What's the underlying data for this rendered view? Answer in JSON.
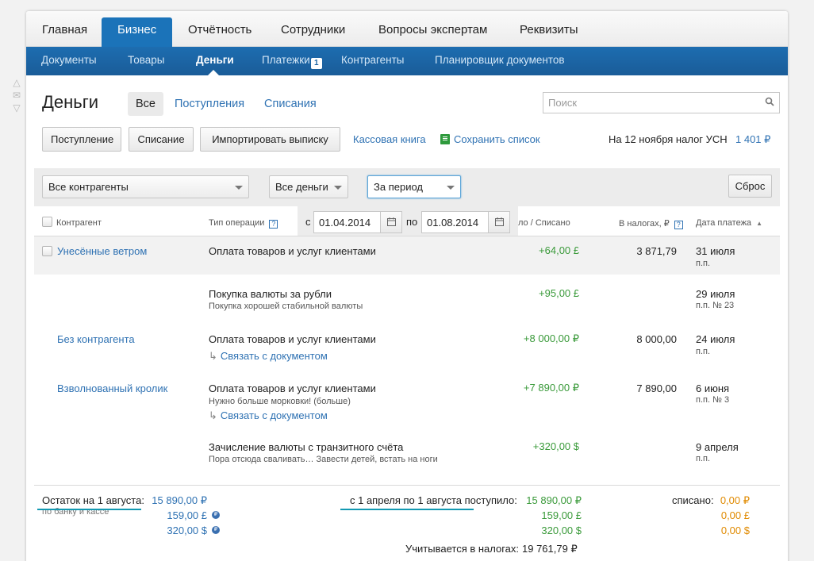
{
  "top_nav": [
    "Главная",
    "Бизнес",
    "Отчётность",
    "Сотрудники",
    "Вопросы экспертам",
    "Реквизиты"
  ],
  "sub_nav": [
    "Документы",
    "Товары",
    "Деньги",
    "Платежки",
    "Контрагенты",
    "Планировщик документов"
  ],
  "sub_nav_badge": "1",
  "page_title": "Деньги",
  "filter_tabs": [
    "Все",
    "Поступления",
    "Списания"
  ],
  "search_placeholder": "Поиск",
  "buttons": {
    "income": "Поступление",
    "writeoff": "Списание",
    "import": "Импортировать выписку",
    "cashbook": "Кассовая книга",
    "save_list": "Сохранить список",
    "tax_label": "На 12 ноября налог УСН",
    "tax_value": "1 401 ₽"
  },
  "filters": {
    "counterparty": "Все контрагенты",
    "money": "Все деньги",
    "period": "За период",
    "reset": "Сброс",
    "from_label": "с",
    "from_date": "01.04.2014",
    "to_label": "по",
    "to_date": "01.08.2014"
  },
  "columns": {
    "counterparty": "Контрагент",
    "operation": "Тип операции",
    "amount": "ло / Списано",
    "taxes": "В налогах, ₽",
    "date": "Дата платежа"
  },
  "rows": [
    {
      "counterparty": "Унесённые ветром",
      "operation": "Оплата товаров и услуг клиентами",
      "note": "",
      "link": "",
      "amount": "+64,00 £",
      "taxes": "3 871,79",
      "date": "31 июля",
      "doc": "п.п."
    },
    {
      "counterparty": "",
      "operation": "Покупка валюты за рубли",
      "note": "Покупка хорошей стабильной валюты",
      "link": "",
      "amount": "+95,00 £",
      "taxes": "",
      "date": "29 июля",
      "doc": "п.п. № 23"
    },
    {
      "counterparty": "Без контрагента",
      "operation": "Оплата товаров и услуг клиентами",
      "note": "",
      "link": "Связать с документом",
      "amount": "+8 000,00 ₽",
      "taxes": "8 000,00",
      "date": "24 июля",
      "doc": "п.п."
    },
    {
      "counterparty": "Взволнованный кролик",
      "operation": "Оплата товаров и услуг клиентами",
      "note": "Нужно больше морковки! (больше)",
      "link": "Связать с документом",
      "amount": "+7 890,00 ₽",
      "taxes": "7 890,00",
      "date": "6 июня",
      "doc": "п.п. № 3"
    },
    {
      "counterparty": "",
      "operation": "Зачисление валюты с транзитного счёта",
      "note": "Пора отсюда сваливать… Завести детей, встать на ноги",
      "link": "",
      "amount": "+320,00 $",
      "taxes": "",
      "date": "9 апреля",
      "doc": "п.п."
    }
  ],
  "summary": {
    "balance_label": "Остаток на 1 августа:",
    "balance_note": "по банку и кассе",
    "balances": [
      "15 890,00 ₽",
      "159,00 £",
      "320,00 $"
    ],
    "income_label": "с 1 апреля по 1 августа поступило:",
    "incomes": [
      "15 890,00 ₽",
      "159,00 £",
      "320,00 $"
    ],
    "spent_label": "списано:",
    "spent": [
      "0,00 ₽",
      "0,00 £",
      "0,00 $"
    ],
    "taxes_label": "Учитывается в налогах:",
    "taxes_value": "19 761,79 ₽"
  }
}
